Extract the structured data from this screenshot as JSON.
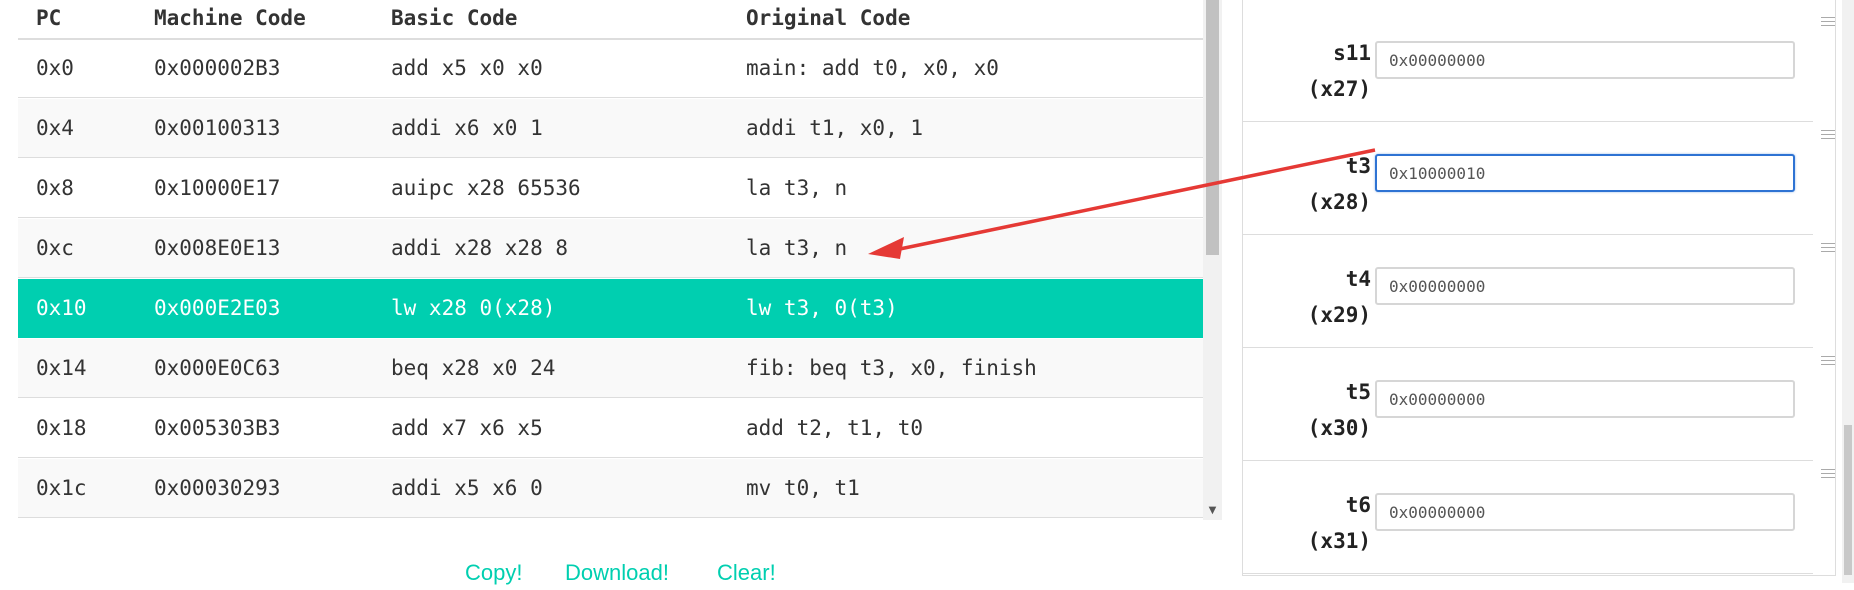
{
  "code_table": {
    "headers": {
      "pc": "PC",
      "machine_code": "Machine Code",
      "basic_code": "Basic Code",
      "original_code": "Original Code"
    },
    "rows": [
      {
        "pc": "0x0",
        "machine_code": "0x000002B3",
        "basic_code": "add x5 x0 x0",
        "original_code": "main: add t0, x0, x0"
      },
      {
        "pc": "0x4",
        "machine_code": "0x00100313",
        "basic_code": "addi x6 x0 1",
        "original_code": "addi t1, x0, 1"
      },
      {
        "pc": "0x8",
        "machine_code": "0x10000E17",
        "basic_code": "auipc x28 65536",
        "original_code": "la t3, n"
      },
      {
        "pc": "0xc",
        "machine_code": "0x008E0E13",
        "basic_code": "addi x28 x28 8",
        "original_code": "la t3, n"
      },
      {
        "pc": "0x10",
        "machine_code": "0x000E2E03",
        "basic_code": "lw x28 0(x28)",
        "original_code": "lw t3, 0(t3)"
      },
      {
        "pc": "0x14",
        "machine_code": "0x000E0C63",
        "basic_code": "beq x28 x0 24",
        "original_code": "fib: beq t3, x0, finish"
      },
      {
        "pc": "0x18",
        "machine_code": "0x005303B3",
        "basic_code": "add x7 x6 x5",
        "original_code": "add t2, t1, t0"
      },
      {
        "pc": "0x1c",
        "machine_code": "0x00030293",
        "basic_code": "addi x5 x6 0",
        "original_code": "mv t0, t1"
      }
    ],
    "current_pc": "0x10",
    "scroll_down_glyph": "▼"
  },
  "actions": {
    "copy": "Copy!",
    "download": "Download!",
    "clear": "Clear!"
  },
  "registers": [
    {
      "alias": "s11",
      "num": "(x27)",
      "value": "0x00000000"
    },
    {
      "alias": "t3",
      "num": "(x28)",
      "value": "0x10000010"
    },
    {
      "alias": "t4",
      "num": "(x29)",
      "value": "0x00000000"
    },
    {
      "alias": "t5",
      "num": "(x30)",
      "value": "0x00000000"
    },
    {
      "alias": "t6",
      "num": "(x31)",
      "value": "0x00000000"
    }
  ],
  "focused_register": "t3",
  "colors": {
    "highlight": "#00cfb0",
    "annotation_arrow": "#e53935",
    "focus_border": "#2e73d3"
  }
}
